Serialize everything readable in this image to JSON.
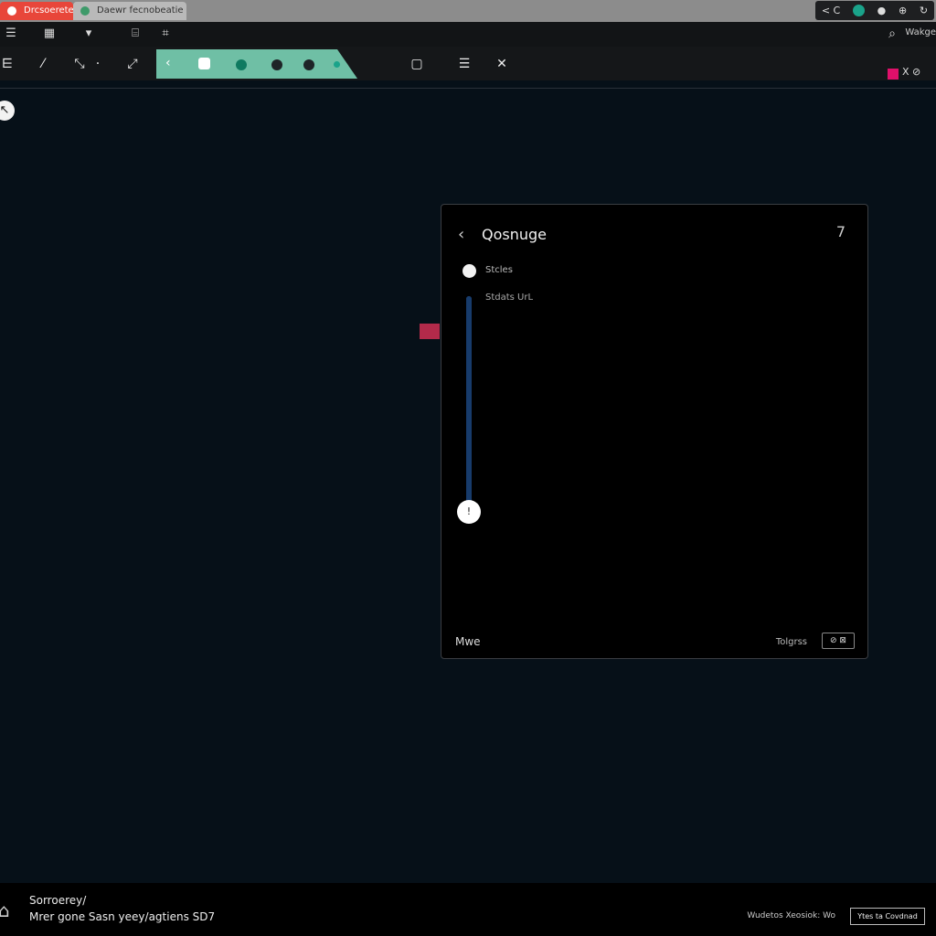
{
  "tabs": [
    {
      "label": "Drcsoerete",
      "color": "#e8463a"
    },
    {
      "label": "Daewr fecnobeatie",
      "color": "#b9b9b9"
    }
  ],
  "tray": {
    "icons": [
      "back-icon",
      "sync-icon",
      "record-icon",
      "globe-icon",
      "refresh-icon"
    ],
    "back_label": "< C"
  },
  "menu": {
    "user_label": "Wakge"
  },
  "toolbar": {
    "accent_color": "#6fbfa5",
    "flag_color": "#e0106a",
    "right_tools_label": "X ⊘"
  },
  "panel": {
    "title": "Qosnuge",
    "corner": "7",
    "option_label": "Stcles",
    "option_sub": "Stdats UrL",
    "slider_value": 1,
    "slider_thumb_label": "!",
    "footer_left": "Mwe",
    "footer_right": "Tolgrss",
    "footer_button": "⊘ ⊠",
    "accent_color": "#1e3f6e"
  },
  "status": {
    "title": "Sorroerey/",
    "line": "Mrer gone Sasn yeey/agtiens SD7",
    "right": "Wudetos Xeosiok: Wo",
    "button": "Ytes ta Covdnad"
  }
}
